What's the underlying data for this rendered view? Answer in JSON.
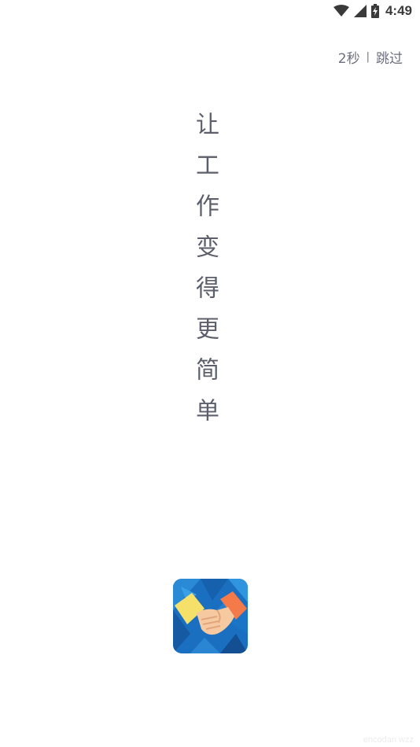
{
  "status_bar": {
    "time": "4:49",
    "icons": [
      "wifi-icon",
      "cell-signal-icon",
      "battery-charging-icon"
    ]
  },
  "skip": {
    "countdown": "2秒",
    "separator": "|",
    "label": "跳过"
  },
  "slogan": "让工作变得更简单",
  "logo": {
    "icon": "handshake-icon",
    "colors": {
      "background": "#1a6fc0",
      "left_hand": "#f5e06a",
      "right_hand": "#f47a4a",
      "skin": "#f6c9a0"
    }
  },
  "watermark": "encodan wzz"
}
